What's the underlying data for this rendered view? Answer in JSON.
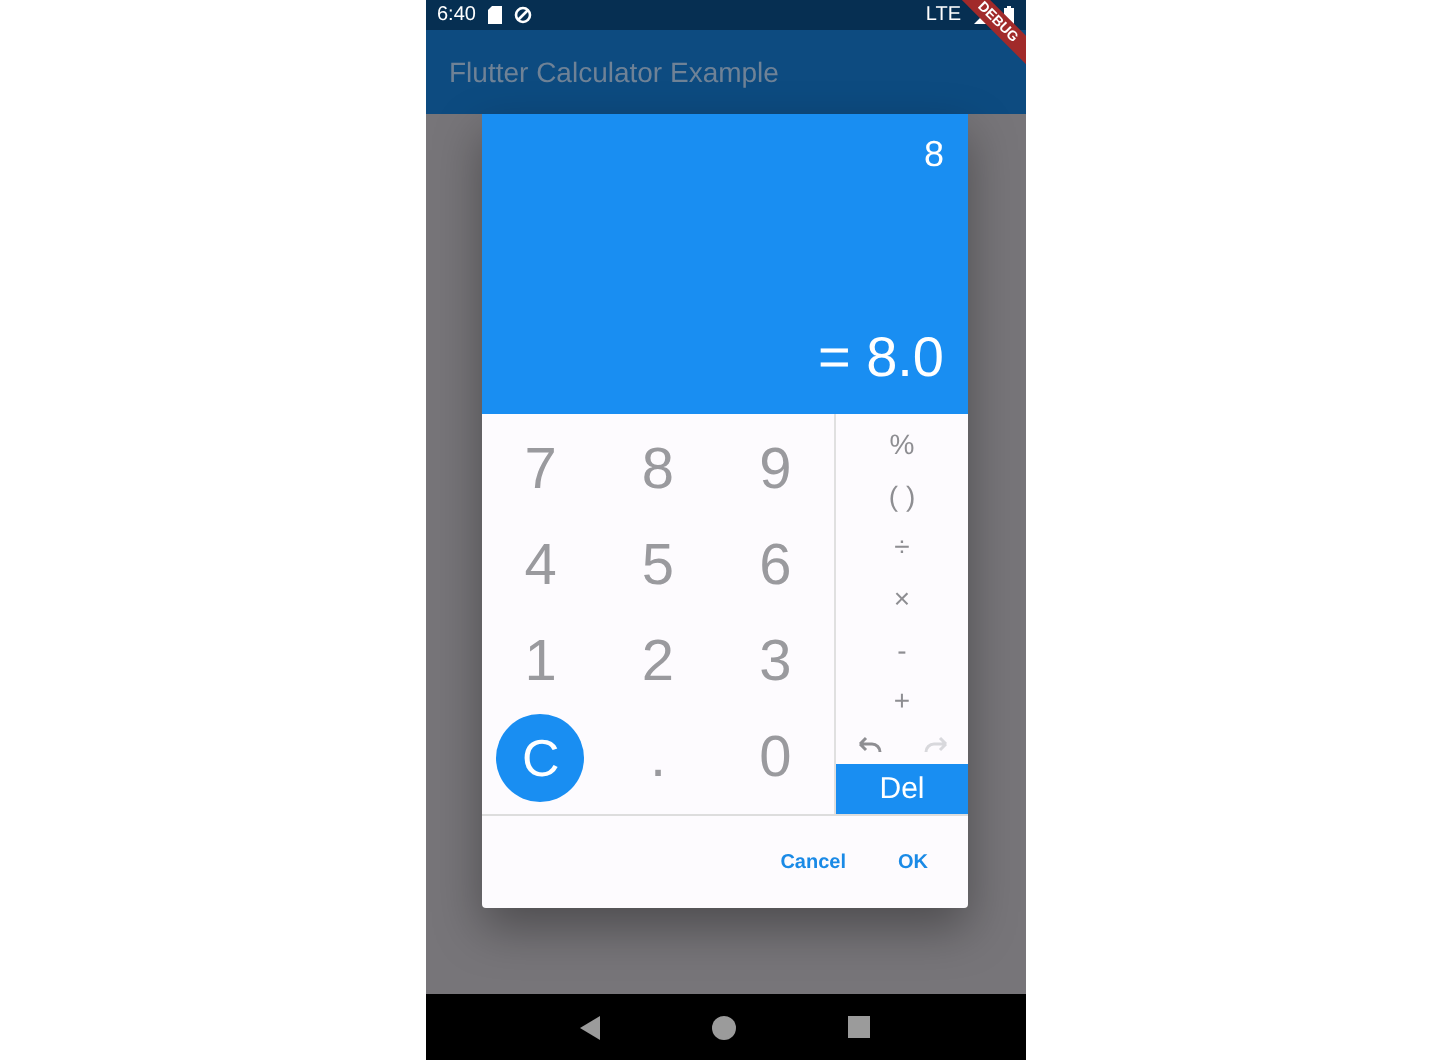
{
  "status_bar": {
    "time": "6:40",
    "network": "LTE"
  },
  "debug_banner": {
    "label": "DEBUG"
  },
  "app_bar": {
    "title": "Flutter Calculator Example"
  },
  "dialog": {
    "expression": "8",
    "result": "= 8.0",
    "keys": [
      {
        "label": "7",
        "kind": "digit"
      },
      {
        "label": "8",
        "kind": "digit"
      },
      {
        "label": "9",
        "kind": "digit"
      },
      {
        "label": "4",
        "kind": "digit"
      },
      {
        "label": "5",
        "kind": "digit"
      },
      {
        "label": "6",
        "kind": "digit"
      },
      {
        "label": "1",
        "kind": "digit"
      },
      {
        "label": "2",
        "kind": "digit"
      },
      {
        "label": "3",
        "kind": "digit"
      },
      {
        "label": "C",
        "kind": "clear"
      },
      {
        "label": ".",
        "kind": "digit"
      },
      {
        "label": "0",
        "kind": "digit"
      }
    ],
    "operators": [
      "%",
      "( )",
      "÷",
      "×",
      "-",
      "+"
    ],
    "history": [
      {
        "kind": "undo",
        "disabled": false
      },
      {
        "kind": "redo",
        "disabled": true
      }
    ],
    "delete_label": "Del",
    "actions": [
      "Cancel",
      "OK"
    ]
  }
}
